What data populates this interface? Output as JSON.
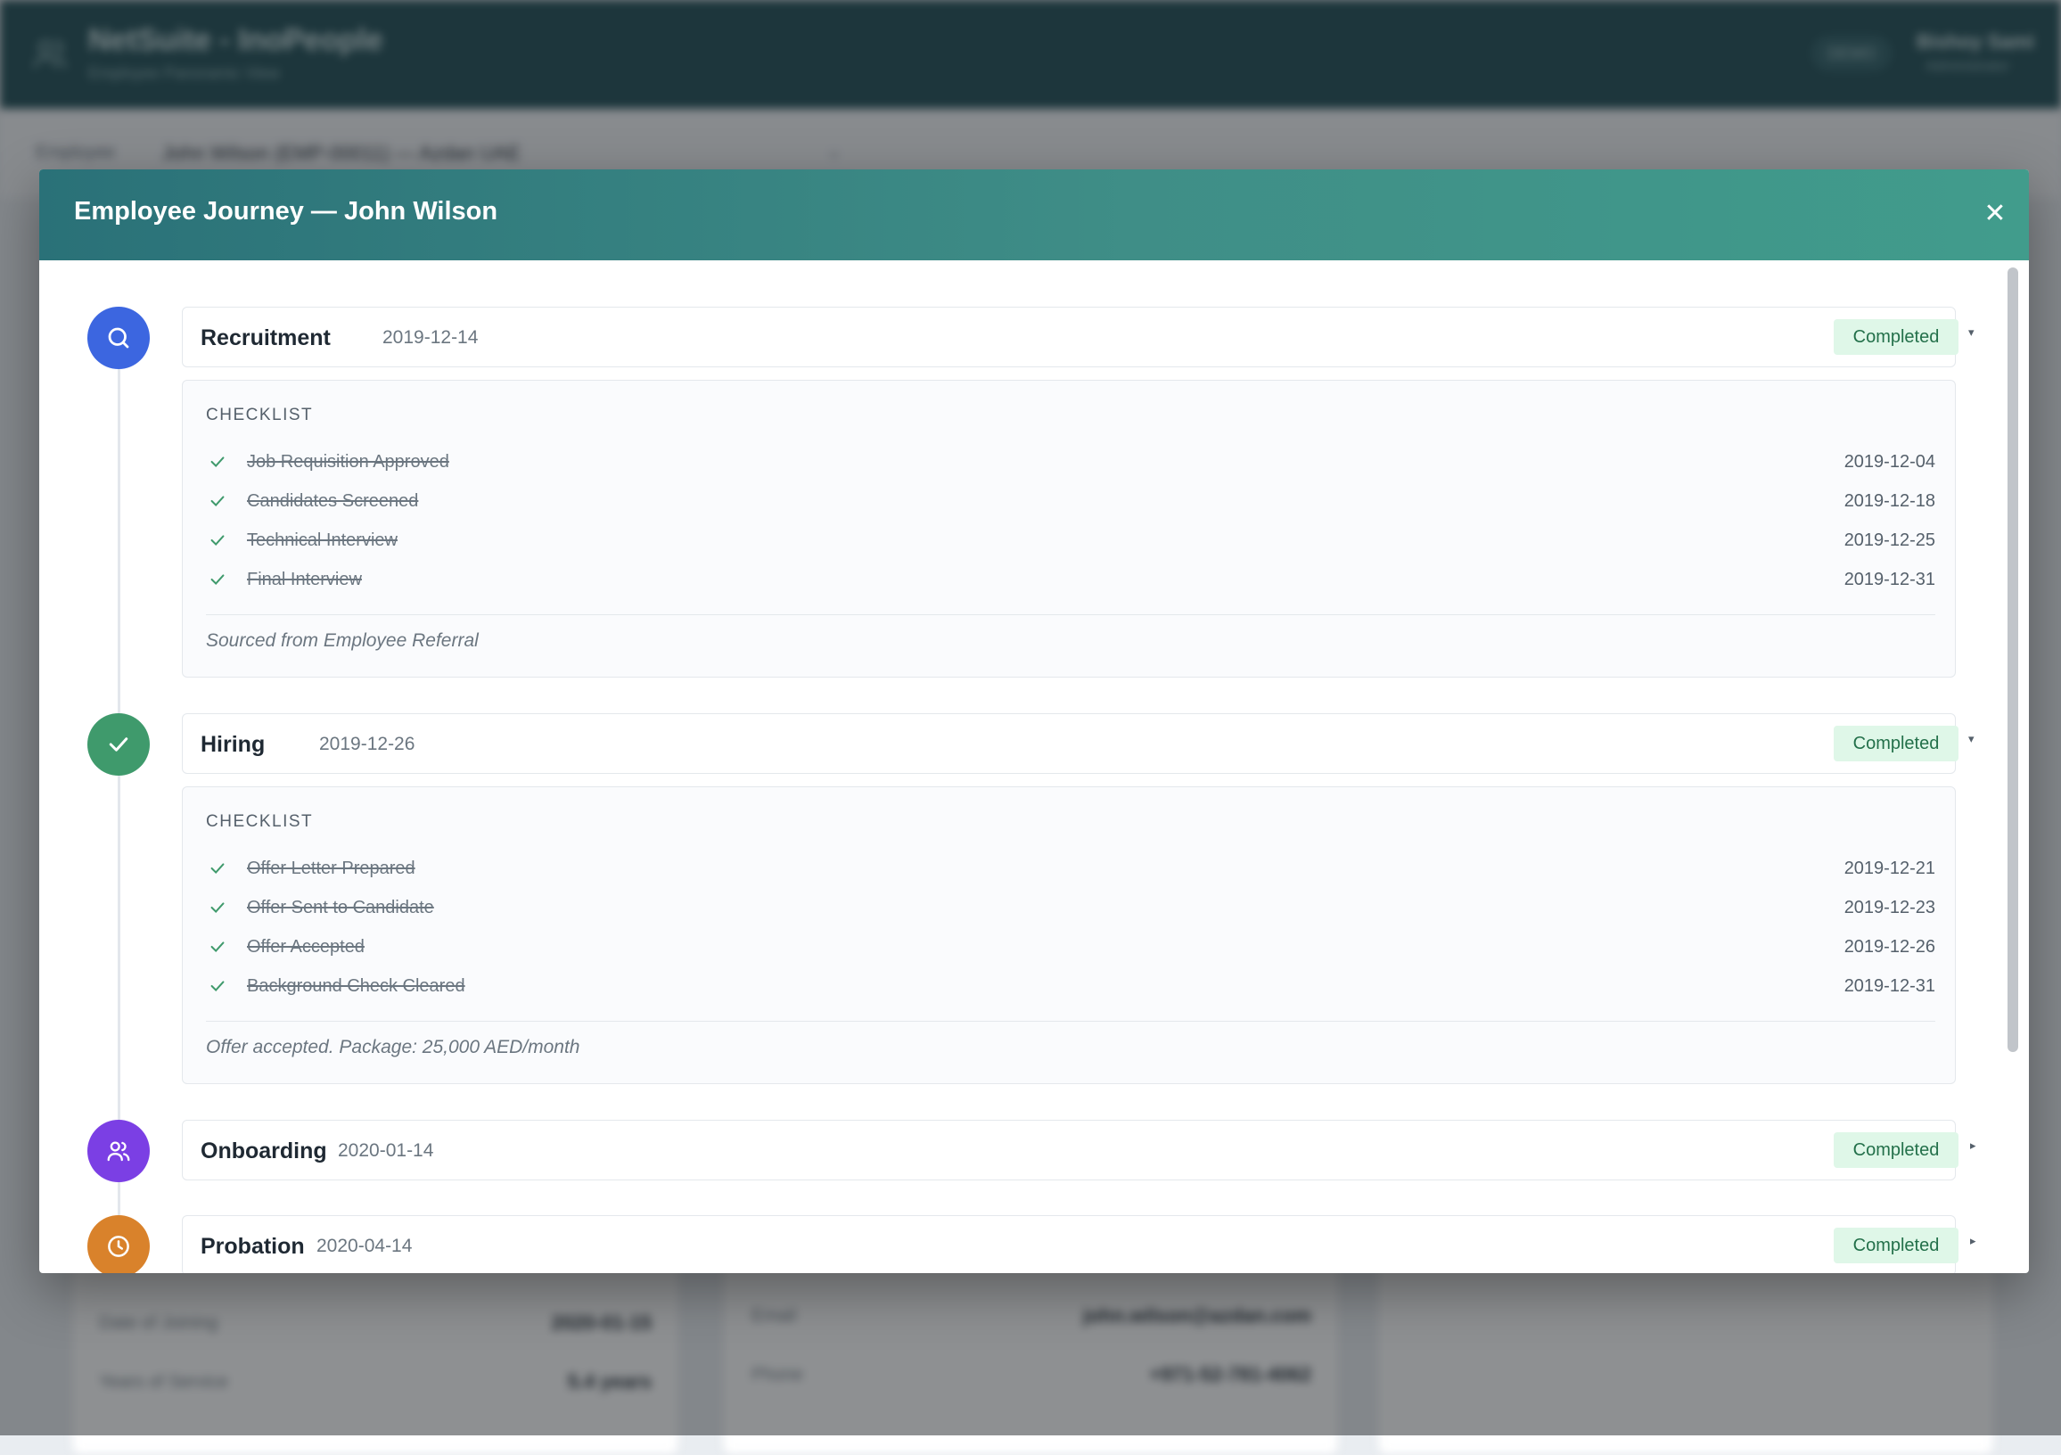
{
  "background_app": {
    "title": "NetSuite - InoPeople",
    "subtitle": "Employee Panoramic View",
    "demo_badge": "DEMO",
    "user_name": "Bishoy Sami",
    "user_role": "Administrator",
    "employee_label": "Employee",
    "employee_selected": "John Wilson (EMP-00011) — Azdan UAE",
    "rows": [
      {
        "label": "Date of Joining",
        "value": "2020-01-15"
      },
      {
        "label": "Years of Service",
        "value": "5.4 years"
      },
      {
        "label": "Email",
        "value": "john.wilson@azdan.com"
      },
      {
        "label": "Phone",
        "value": "+971-52-781-4062"
      }
    ]
  },
  "modal": {
    "title": "Employee Journey — John Wilson",
    "close_symbol": "✕"
  },
  "colors": {
    "recruitment": "#3c66e0",
    "hiring": "#3f9a6c",
    "onboarding": "#7b3fe4",
    "probation": "#d9822b",
    "status_bg": "#dff7e8",
    "status_text": "#23704a"
  },
  "stages": [
    {
      "name": "Recruitment",
      "date": "2019-12-14",
      "status": "Completed",
      "icon": "search-icon",
      "toggle": "▾",
      "checklist_heading": "CHECKLIST",
      "items": [
        {
          "label": "Job Requisition Approved",
          "date": "2019-12-04"
        },
        {
          "label": "Candidates Screened",
          "date": "2019-12-18"
        },
        {
          "label": "Technical Interview",
          "date": "2019-12-25"
        },
        {
          "label": "Final Interview",
          "date": "2019-12-31"
        }
      ],
      "note": "Sourced from Employee Referral"
    },
    {
      "name": "Hiring",
      "date": "2019-12-26",
      "status": "Completed",
      "icon": "check-icon",
      "toggle": "▾",
      "checklist_heading": "CHECKLIST",
      "items": [
        {
          "label": "Offer Letter Prepared",
          "date": "2019-12-21"
        },
        {
          "label": "Offer Sent to Candidate",
          "date": "2019-12-23"
        },
        {
          "label": "Offer Accepted",
          "date": "2019-12-26"
        },
        {
          "label": "Background Check Cleared",
          "date": "2019-12-31"
        }
      ],
      "note": "Offer accepted. Package: 25,000 AED/month"
    },
    {
      "name": "Onboarding",
      "date": "2020-01-14",
      "status": "Completed",
      "icon": "users-icon",
      "toggle": "▸"
    },
    {
      "name": "Probation",
      "date": "2020-04-14",
      "status": "Completed",
      "icon": "clock-icon",
      "toggle": "▸"
    }
  ]
}
